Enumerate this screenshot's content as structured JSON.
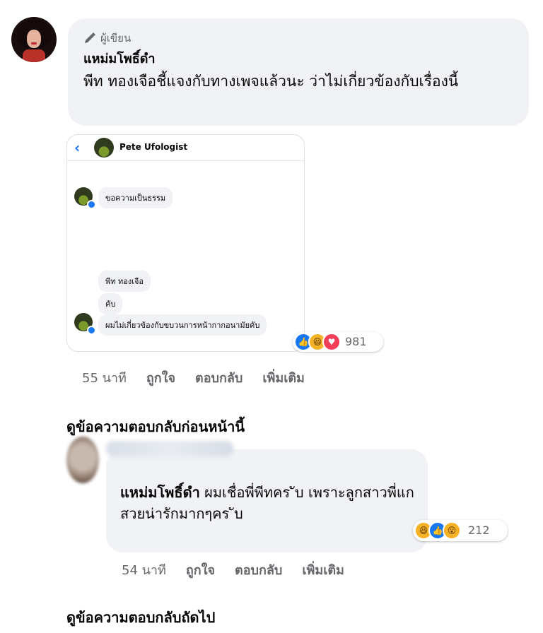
{
  "comment1": {
    "badge_label": "ผู้เขียน",
    "badge_icon": "pen-icon",
    "author": "แหม่มโพธิ์ดำ",
    "text": "พีท ทองเจือชี้แจงกับทางเพจแล้วนะ ว่าไม่เกี่ยวข้องกับเรื่องนี้",
    "screenshot": {
      "page_name": "Pete Ufologist",
      "messages": [
        "ขอความเป็นธรรม",
        "พีท ทองเจือ",
        "คับ",
        "ผมไม่เกี่ยวข้องกับขบวนการหน้ากากอนามัยคับ"
      ]
    },
    "reactions": {
      "icons": [
        "like",
        "haha",
        "love"
      ],
      "count": "981"
    },
    "meta": {
      "time": "55 นาที",
      "like": "ถูกใจ",
      "reply": "ตอบกลับ",
      "more": "เพิ่มเติม"
    }
  },
  "view_previous_replies": "ดูข้อความตอบกลับก่อนหน้านี้",
  "reply1": {
    "mention": "แหม่มโพธิ์ดำ",
    "text": " ผมเชื่อพี่พีทคร ับ เพราะลูกสาวพี่แก สวยน่ารักมากๆคร ับ",
    "reactions": {
      "icons": [
        "haha",
        "like",
        "wow"
      ],
      "count": "212"
    },
    "meta": {
      "time": "54 นาที",
      "like": "ถูกใจ",
      "reply": "ตอบกลับ",
      "more": "เพิ่มเติม"
    }
  },
  "view_next_replies": "ดูข้อความตอบกลับถัดไป",
  "colors": {
    "bubble": "#f0f2f5",
    "accent": "#1877f2",
    "meta": "#65676b"
  }
}
